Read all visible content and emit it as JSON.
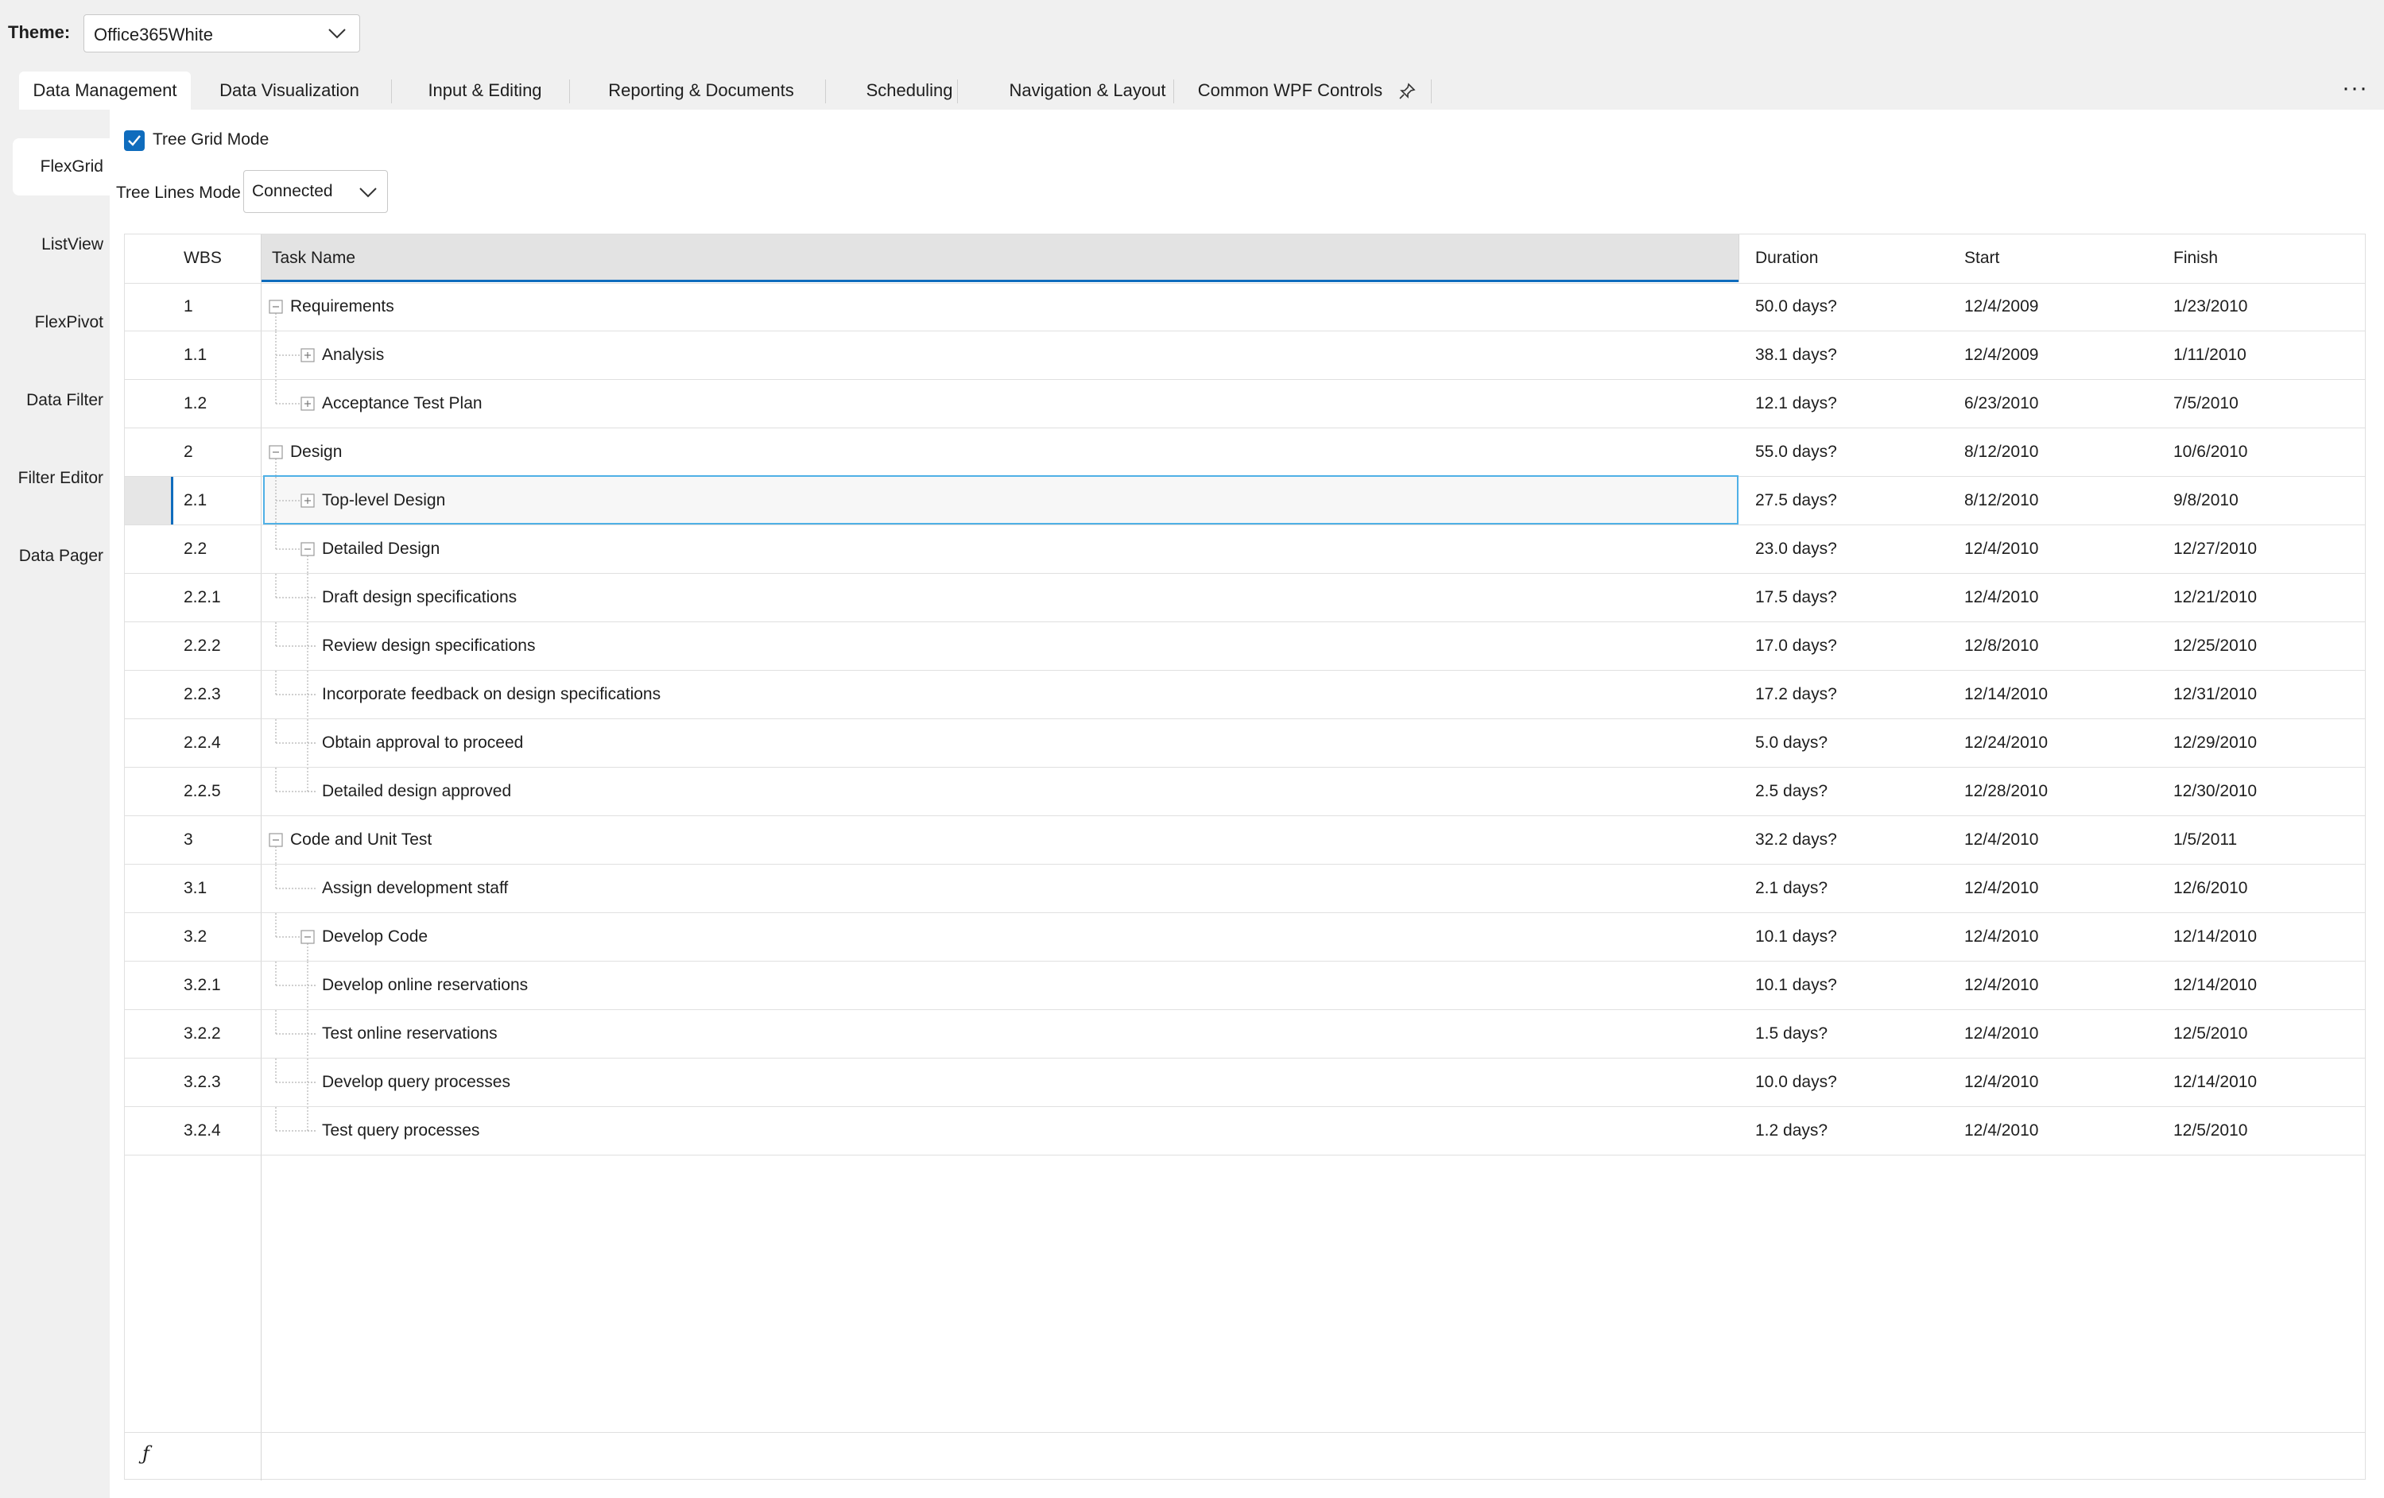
{
  "theme": {
    "label": "Theme:",
    "value": "Office365White"
  },
  "tabs": [
    {
      "label": "Data Management",
      "active": true
    },
    {
      "label": "Data Visualization"
    },
    {
      "label": "Input & Editing"
    },
    {
      "label": "Reporting & Documents"
    },
    {
      "label": "Scheduling"
    },
    {
      "label": "Navigation & Layout"
    },
    {
      "label": "Common WPF Controls",
      "icon": "pin-icon"
    }
  ],
  "more_label": "···",
  "sidebar": {
    "items": [
      {
        "label": "FlexGrid",
        "active": true
      },
      {
        "label": "ListView"
      },
      {
        "label": "FlexPivot"
      },
      {
        "label": "Data Filter"
      },
      {
        "label": "Filter Editor"
      },
      {
        "label": "Data Pager"
      }
    ]
  },
  "options": {
    "tree_grid_mode_label": "Tree Grid Mode",
    "tree_grid_mode_checked": true,
    "tree_lines_mode_label": "Tree Lines Mode",
    "tree_lines_mode_value": "Connected"
  },
  "grid": {
    "columns": [
      "WBS",
      "Task Name",
      "Duration",
      "Start",
      "Finish"
    ],
    "sorted_column": "Task Name",
    "rows": [
      {
        "wbs": "1",
        "name": "Requirements",
        "level": 0,
        "toggle": "collapse",
        "duration": "50.0 days?",
        "start": "12/4/2009",
        "finish": "1/23/2010"
      },
      {
        "wbs": "1.1",
        "name": "Analysis",
        "level": 1,
        "toggle": "expand",
        "duration": "38.1 days?",
        "start": "12/4/2009",
        "finish": "1/11/2010"
      },
      {
        "wbs": "1.2",
        "name": "Acceptance Test Plan",
        "level": 1,
        "toggle": "expand",
        "duration": "12.1 days?",
        "start": "6/23/2010",
        "finish": "7/5/2010"
      },
      {
        "wbs": "2",
        "name": "Design",
        "level": 0,
        "toggle": "collapse",
        "duration": "55.0 days?",
        "start": "8/12/2010",
        "finish": "10/6/2010"
      },
      {
        "wbs": "2.1",
        "name": "Top-level Design",
        "level": 1,
        "toggle": "expand",
        "duration": "27.5 days?",
        "start": "8/12/2010",
        "finish": "9/8/2010",
        "selected": true
      },
      {
        "wbs": "2.2",
        "name": "Detailed Design",
        "level": 1,
        "toggle": "collapse",
        "duration": "23.0 days?",
        "start": "12/4/2010",
        "finish": "12/27/2010"
      },
      {
        "wbs": "2.2.1",
        "name": "Draft design specifications",
        "level": 2,
        "duration": "17.5 days?",
        "start": "12/4/2010",
        "finish": "12/21/2010"
      },
      {
        "wbs": "2.2.2",
        "name": "Review design specifications",
        "level": 2,
        "duration": "17.0 days?",
        "start": "12/8/2010",
        "finish": "12/25/2010"
      },
      {
        "wbs": "2.2.3",
        "name": "Incorporate feedback on design specifications",
        "level": 2,
        "duration": "17.2 days?",
        "start": "12/14/2010",
        "finish": "12/31/2010"
      },
      {
        "wbs": "2.2.4",
        "name": "Obtain approval to proceed",
        "level": 2,
        "duration": "5.0 days?",
        "start": "12/24/2010",
        "finish": "12/29/2010"
      },
      {
        "wbs": "2.2.5",
        "name": "Detailed design approved",
        "level": 2,
        "duration": "2.5 days?",
        "start": "12/28/2010",
        "finish": "12/30/2010"
      },
      {
        "wbs": "3",
        "name": "Code and Unit Test",
        "level": 0,
        "toggle": "collapse",
        "duration": "32.2 days?",
        "start": "12/4/2010",
        "finish": "1/5/2011"
      },
      {
        "wbs": "3.1",
        "name": "Assign development staff",
        "level": 1,
        "duration": "2.1 days?",
        "start": "12/4/2010",
        "finish": "12/6/2010"
      },
      {
        "wbs": "3.2",
        "name": "Develop Code",
        "level": 1,
        "toggle": "collapse",
        "duration": "10.1 days?",
        "start": "12/4/2010",
        "finish": "12/14/2010"
      },
      {
        "wbs": "3.2.1",
        "name": "Develop online reservations",
        "level": 2,
        "duration": "10.1 days?",
        "start": "12/4/2010",
        "finish": "12/14/2010"
      },
      {
        "wbs": "3.2.2",
        "name": "Test online reservations",
        "level": 2,
        "duration": "1.5 days?",
        "start": "12/4/2010",
        "finish": "12/5/2010"
      },
      {
        "wbs": "3.2.3",
        "name": "Develop query processes",
        "level": 2,
        "duration": "10.0 days?",
        "start": "12/4/2010",
        "finish": "12/14/2010"
      },
      {
        "wbs": "3.2.4",
        "name": "Test query processes",
        "level": 2,
        "duration": "1.2 days?",
        "start": "12/4/2010",
        "finish": "12/5/2010"
      }
    ],
    "footer_icon": "function-icon",
    "footer_symbol": "ƒ"
  }
}
